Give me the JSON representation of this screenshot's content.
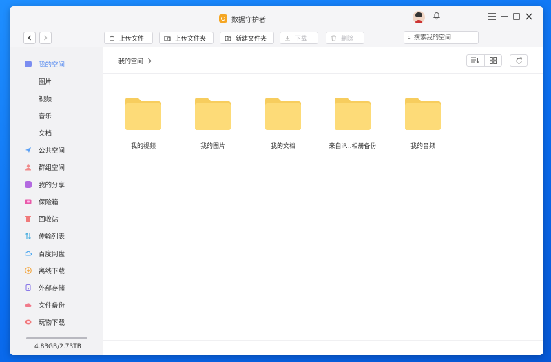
{
  "window": {
    "title": "数据守护者"
  },
  "toolbar": {
    "upload_file": "上传文件",
    "upload_folder": "上传文件夹",
    "new_folder": "新建文件夹",
    "download": "下载",
    "delete": "删除",
    "search_placeholder": "搜索我的空间"
  },
  "sidebar": {
    "items": [
      {
        "label": "我的空间",
        "icon": "my-space-icon",
        "color": "#7b8df0",
        "active": true
      },
      {
        "label": "图片"
      },
      {
        "label": "视频"
      },
      {
        "label": "音乐"
      },
      {
        "label": "文档"
      },
      {
        "label": "公共空间",
        "icon": "send-icon",
        "color": "#5aa0f5"
      },
      {
        "label": "群组空间",
        "icon": "group-icon",
        "color": "#f08a8a"
      },
      {
        "label": "我的分享",
        "icon": "share-icon",
        "color": "#b36ae0"
      },
      {
        "label": "保险箱",
        "icon": "safe-icon",
        "color": "#e85aa8"
      },
      {
        "label": "回收站",
        "icon": "trash-icon",
        "color": "#f07a7a"
      },
      {
        "label": "传输列表",
        "icon": "transfer-icon",
        "color": "#4fb0e0"
      },
      {
        "label": "百度网盘",
        "icon": "baidu-cloud-icon",
        "color": "#4aa6f0"
      },
      {
        "label": "离线下载",
        "icon": "offline-download-icon",
        "color": "#f2a640"
      },
      {
        "label": "外部存储",
        "icon": "external-storage-icon",
        "color": "#8b7ae8"
      },
      {
        "label": "文件备份",
        "icon": "backup-icon",
        "color": "#f07a8a"
      },
      {
        "label": "玩物下载",
        "icon": "wanwu-download-icon",
        "color": "#f07a7a"
      }
    ],
    "storage": {
      "text": "4.83GB/2.73TB",
      "used_fraction": 0.0017
    }
  },
  "breadcrumb": {
    "current": "我的空间"
  },
  "folders": [
    {
      "name": "我的视频"
    },
    {
      "name": "我的图片"
    },
    {
      "name": "我的文档"
    },
    {
      "name": "来自iP...相册备份"
    },
    {
      "name": "我的音频"
    }
  ],
  "colors": {
    "accent": "#5b8ef0",
    "folder": "#fddb78",
    "folder_tab": "#f7cd5e"
  }
}
